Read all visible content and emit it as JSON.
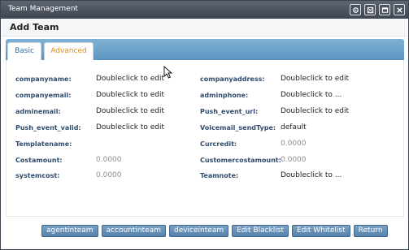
{
  "window": {
    "title": "Team Management"
  },
  "header": {
    "title": "Add Team"
  },
  "tabs": [
    {
      "label": "Basic"
    },
    {
      "label": "Advanced"
    }
  ],
  "fields": [
    {
      "label": "companyname:",
      "value": "Doubleclick to edit"
    },
    {
      "label": "companyaddress:",
      "value": "Doubleclick to edit"
    },
    {
      "label": "companyemail:",
      "value": "Doubleclick to edit"
    },
    {
      "label": "adminphone:",
      "value": "Doubleclick to ..."
    },
    {
      "label": "adminemail:",
      "value": "Doubleclick to edit"
    },
    {
      "label": "Push_event_url:",
      "value": "Doubleclick to edit"
    },
    {
      "label": "Push_event_valid:",
      "value": "Doubleclick to edit"
    },
    {
      "label": "Voicemail_sendType:",
      "value": "default"
    },
    {
      "label": "Templatename:",
      "value": ""
    },
    {
      "label": "Curcredit:",
      "value": "0.0000"
    },
    {
      "label": "Costamount:",
      "value": "0.0000"
    },
    {
      "label": "Customercostamount:",
      "value": "0.0000"
    },
    {
      "label": "systemcost:",
      "value": "0.0000"
    },
    {
      "label": "Teamnote:",
      "value": "Doubleclick to ..."
    }
  ],
  "buttons": [
    {
      "label": "agentinteam"
    },
    {
      "label": "accountinteam"
    },
    {
      "label": "deviceinteam"
    },
    {
      "label": "Edit Blacklist"
    },
    {
      "label": "Edit Whitelist"
    },
    {
      "label": "Return"
    }
  ],
  "window_controls": [
    "settings-icon",
    "restore-icon",
    "maximize-icon",
    "close-icon"
  ],
  "colors": {
    "titlebar": "#4a525e",
    "tabbar": "#6aa3cb",
    "active_tab_text": "#e0901c",
    "label_text": "#2f4b6e",
    "button": "#6690b8"
  }
}
